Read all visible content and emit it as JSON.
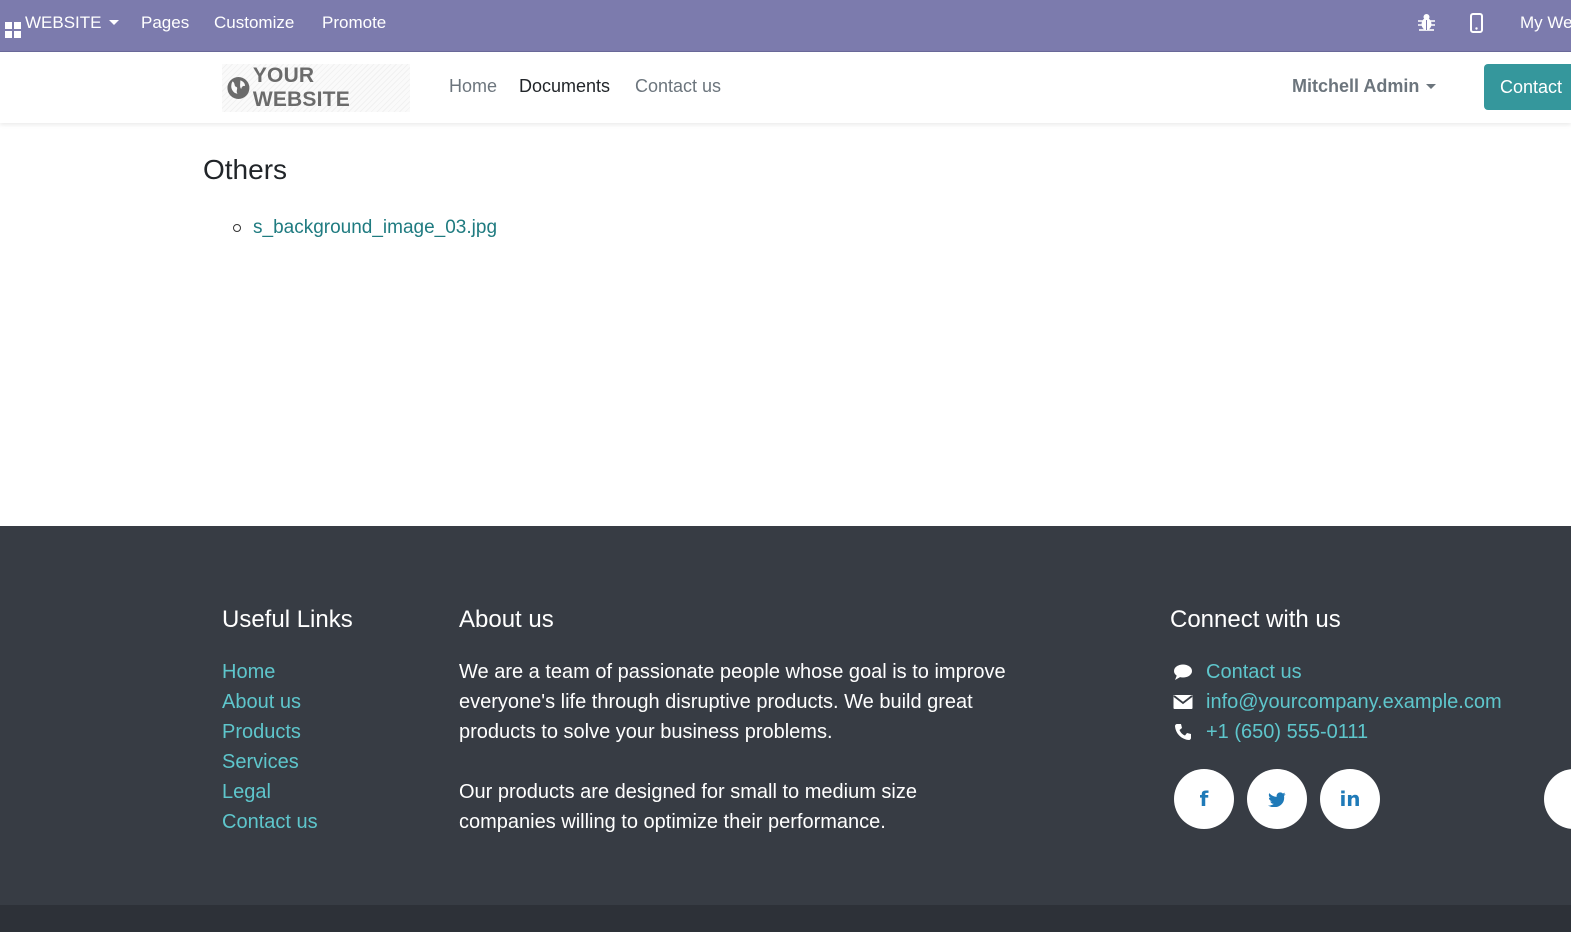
{
  "editor_bar": {
    "website_label": "WEBSITE",
    "pages_label": "Pages",
    "customize_label": "Customize",
    "promote_label": "Promote",
    "my_website_label": "My We"
  },
  "header": {
    "logo_text": "YOUR WEBSITE",
    "nav": [
      {
        "label": "Home"
      },
      {
        "label": "Documents"
      },
      {
        "label": "Contact us"
      }
    ],
    "active_nav": "Documents",
    "user_name": "Mitchell Admin",
    "contact_button": "Contact"
  },
  "main": {
    "section_title": "Others",
    "documents": [
      {
        "name": "s_background_image_03.jpg"
      }
    ]
  },
  "footer": {
    "useful_links_title": "Useful Links",
    "useful_links": [
      {
        "label": "Home"
      },
      {
        "label": "About us"
      },
      {
        "label": "Products"
      },
      {
        "label": "Services"
      },
      {
        "label": "Legal"
      },
      {
        "label": "Contact us"
      }
    ],
    "about_title": "About us",
    "about_paragraphs": [
      "We are a team of passionate people whose goal is to improve everyone's life through disruptive products. We build great products to solve your business problems.",
      "Our products are designed for small to medium size companies willing to optimize their performance."
    ],
    "connect_title": "Connect with us",
    "contact_items": [
      {
        "icon": "comment-icon",
        "label": "Contact us"
      },
      {
        "icon": "envelope-icon",
        "label": "info@yourcompany.example.com"
      },
      {
        "icon": "phone-icon",
        "label": "+1 (650) 555-0111"
      }
    ],
    "social": [
      {
        "icon": "facebook-icon",
        "glyph": "f"
      },
      {
        "icon": "twitter-icon",
        "glyph": "t"
      },
      {
        "icon": "linkedin-icon",
        "glyph": "in"
      }
    ]
  },
  "colors": {
    "editor_bar": "#7c7bad",
    "primary": "#35979c",
    "link": "#1f7b80",
    "footer_bg": "#373c44",
    "footer_link": "#5ec6cc"
  }
}
